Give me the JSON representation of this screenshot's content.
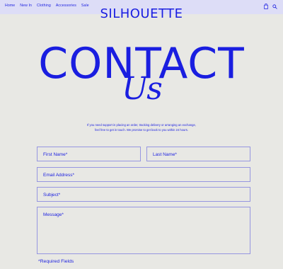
{
  "nav": {
    "items": [
      "Home",
      "New In",
      "Clothing",
      "Accessories",
      "Sale"
    ]
  },
  "brand": "SILHOUETTE",
  "icons": {
    "bag": "shopping-bag-icon",
    "search": "search-icon"
  },
  "hero": {
    "title": "CONTACT",
    "subtitle": "Us",
    "intro_line1": "If you need support in placing an order, tracking delivery or arranging an exchange,",
    "intro_line2": "feel free to get in touch. We promise to get back to you within 24 hours."
  },
  "form": {
    "first_name_placeholder": "First Name*",
    "last_name_placeholder": "Last Name*",
    "email_placeholder": "Email Address*",
    "subject_placeholder": "Subject*",
    "message_placeholder": "Message*",
    "required_note": "*Required Fields"
  },
  "colors": {
    "accent": "#1a1ee0",
    "background": "#e8e8e4",
    "header_tint": "#ddddf7",
    "field_border": "#9696e0"
  }
}
